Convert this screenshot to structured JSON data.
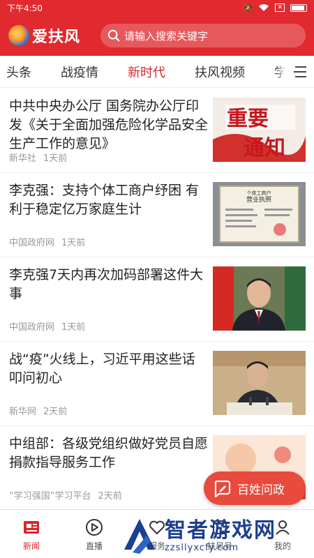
{
  "status_bar": {
    "time": "下午4:50",
    "icons": [
      "mute-icon",
      "wifi-icon",
      "x-icon",
      "battery-icon"
    ]
  },
  "header": {
    "app_name": "爱扶风",
    "search_placeholder": "请输入搜索关键字"
  },
  "tabs": [
    {
      "label": "头条"
    },
    {
      "label": "战疫情"
    },
    {
      "label": "新时代",
      "active": true
    },
    {
      "label": "扶风视频"
    },
    {
      "label": "学"
    }
  ],
  "feed": [
    {
      "title": "中共中央办公厅 国务院办公厅印发《关于全面加强危险化学品安全生产工作的意见》",
      "source": "新华社",
      "time": "1天前",
      "thumb_text": [
        "重要",
        "通知"
      ]
    },
    {
      "title": "李克强：支持个体工商户纾困 有利于稳定亿万家庭生计",
      "source": "中国政府网",
      "time": "1天前",
      "thumb_text": [
        "个体工商户",
        "营业执照"
      ]
    },
    {
      "title": "李克强7天内再次加码部署这件大事",
      "source": "中国政府网",
      "time": "1天前"
    },
    {
      "title": "战“疫”火线上，习近平用这些话叩问初心",
      "source": "新华网",
      "time": "2天前"
    },
    {
      "title": "中组部：各级党组织做好党员自愿捐款指导服务工作",
      "source": "“学习强国”学习平台",
      "time": "2天前"
    }
  ],
  "float_button": {
    "label": "百姓问政"
  },
  "bottom_nav": [
    {
      "label": "新闻",
      "active": true
    },
    {
      "label": "直播"
    },
    {
      "label": "服务"
    },
    {
      "label": "扶风号"
    },
    {
      "label": "我的"
    }
  ],
  "watermark": {
    "title": "智者游戏网",
    "url": "zzsllyxcfy.com"
  },
  "colors": {
    "brand_red": "#e02a2f",
    "active_red": "#d9262c",
    "float_button": "#e84a3e"
  }
}
